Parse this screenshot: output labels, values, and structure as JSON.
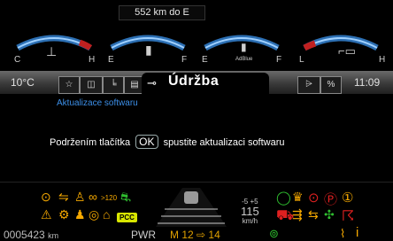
{
  "range_label": "552 km do E",
  "gauges": [
    {
      "left_label": "C",
      "right_label": "H",
      "icon": "coolant-temperature-icon",
      "glyph": "🌡"
    },
    {
      "left_label": "E",
      "right_label": "F",
      "icon": "fuel-pump-icon",
      "glyph": "⛽"
    },
    {
      "left_label": "E",
      "right_label": "F",
      "icon": "adblue-icon",
      "glyph": "⛽",
      "sublabel": "AdBlue"
    },
    {
      "left_label": "L",
      "right_label": "H",
      "icon": "oil-can-icon",
      "glyph": "🛢"
    }
  ],
  "status": {
    "temperature": "10°C",
    "time": "11:09"
  },
  "tabs": {
    "active_title": "Údržba",
    "left_icons": [
      "star-icon",
      "truck-door-icon",
      "trailer-icon",
      "bus-icon",
      "wrench-icon"
    ],
    "right_icons": [
      "road-icon",
      "percent-icon"
    ]
  },
  "content": {
    "heading": "Aktualizace softwaru",
    "instruction_pre": "Podržením tlačítka",
    "ok_label": "OK",
    "instruction_post": "spustite aktualizaci softwaru"
  },
  "bottom": {
    "odometer": "0005423",
    "odometer_unit": "km",
    "power_label": "PWR",
    "gear_text": "M 12 ⇨ 14",
    "pcc_label": "PCC",
    "speed_range": "-5  +5",
    "speed_value": "115",
    "speed_unit": "km/h",
    "distance_badge": ">120"
  },
  "colors": {
    "accent_blue": "#3c8fe8",
    "warning_amber": "#f5a800",
    "indicator_green": "#2fbf2f",
    "indicator_red": "#e02020"
  }
}
